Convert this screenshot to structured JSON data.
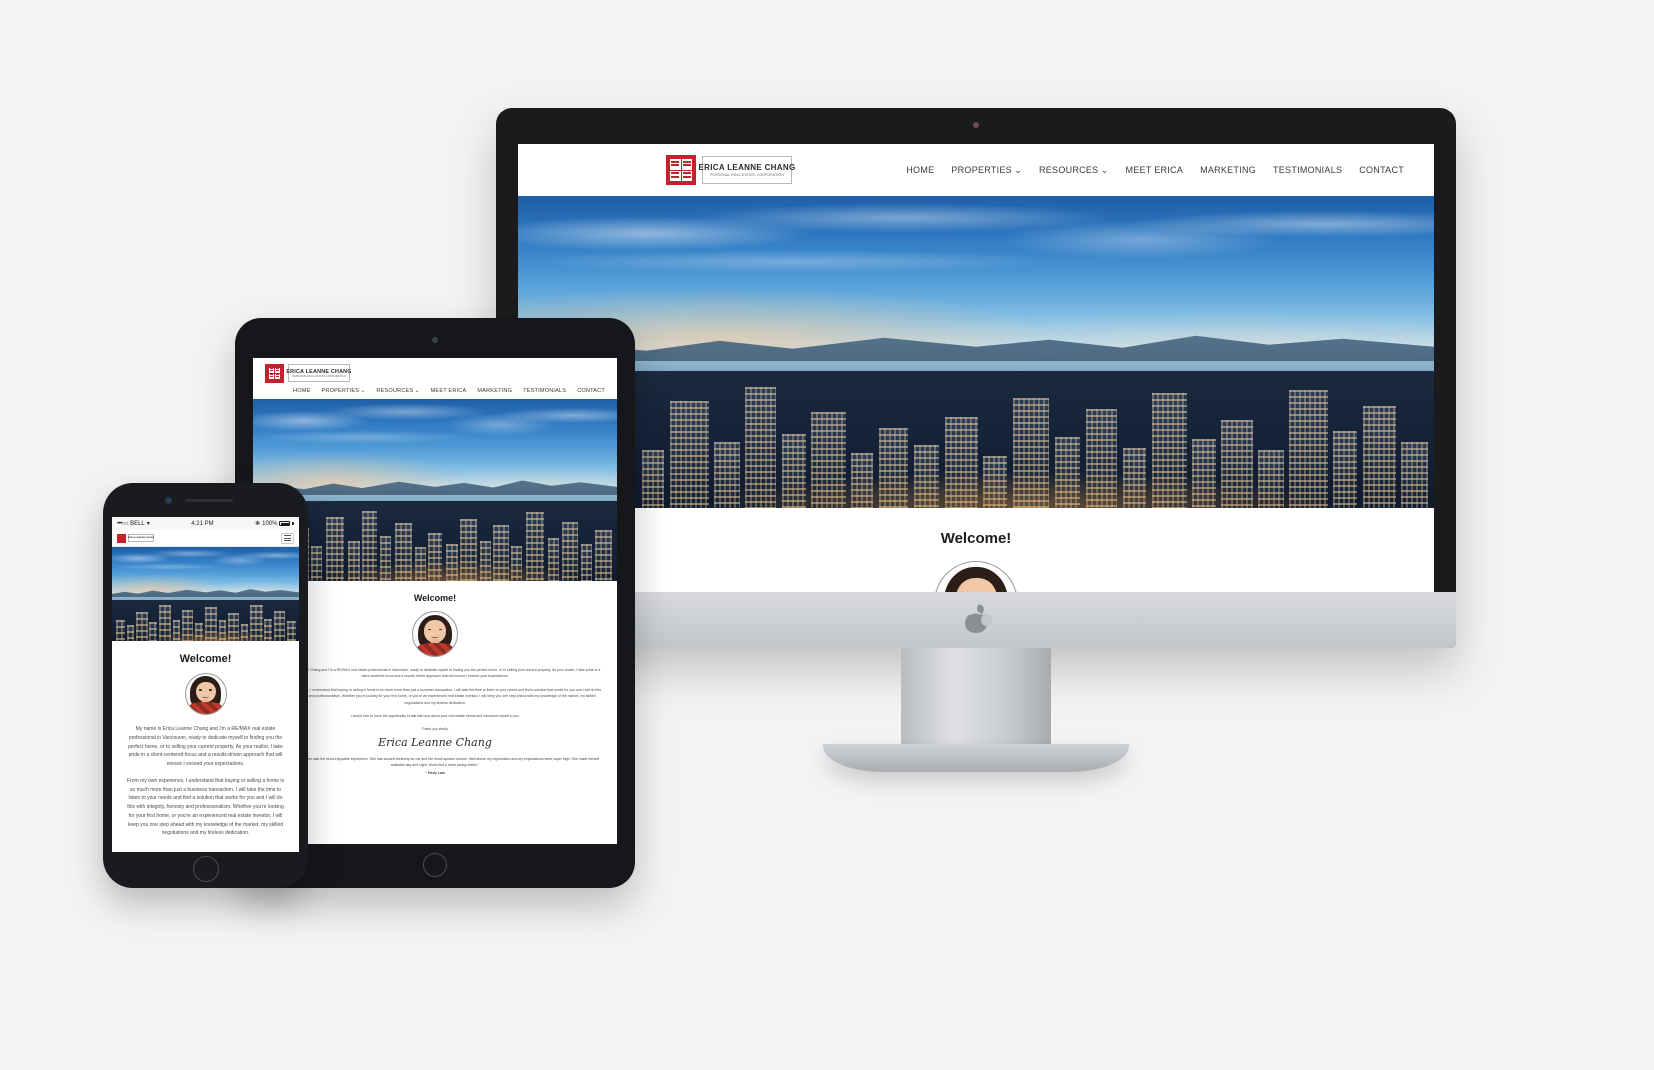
{
  "scene": {
    "background_color": "#f3f3f3",
    "description": "Responsive website mockup shown on iMac desktop, iPad tablet and iPhone"
  },
  "site": {
    "brand": {
      "seal_alt": "red-chinese-seal",
      "name": "ERICA LEANNE CHANG",
      "subtitle": "PERSONAL REAL ESTATE CORPORATION",
      "accent_color": "#c0232b"
    },
    "nav": [
      {
        "label": "HOME",
        "has_dropdown": false
      },
      {
        "label": "PROPERTIES",
        "has_dropdown": true
      },
      {
        "label": "RESOURCES",
        "has_dropdown": true
      },
      {
        "label": "MEET ERICA",
        "has_dropdown": false
      },
      {
        "label": "MARKETING",
        "has_dropdown": false
      },
      {
        "label": "TESTIMONIALS",
        "has_dropdown": false
      },
      {
        "label": "CONTACT",
        "has_dropdown": false
      }
    ],
    "caret_glyph": "⌄",
    "hero_alt": "vancouver-city-skyline-at-dusk",
    "welcome": {
      "title": "Welcome!",
      "avatar_alt": "portrait-of-erica-leanne-chang",
      "paragraph_1": "My name is Erica Leanne Chang and I'm a RE/MAX real estate professional in Vancouver, ready to dedicate myself to finding you the perfect home, or to selling your current property. As your realtor, I take pride in a client-centered focus and a results-driven approach that will ensure I exceed your expectations.",
      "paragraph_2": "From my own experience, I understand that buying or selling a home is so much more than just a business transaction. I will take the time to listen to your needs and find a solution that works for you and I will do this with integrity, honesty and professionalism. Whether you're looking for your first home, or you're an experienced real estate investor, I will keep you one step ahead with my knowledge of the market, my skilled negotiations and my tireless dedication.",
      "paragraph_3": "I would love to have the opportunity to talk with you about your real estate needs and introduce myself to you",
      "closing": "Thank you kindly,",
      "signature": "Erica Leanne Chang"
    },
    "testimonial": {
      "quote": "\"Erica made my first home sale the most enjoyable experience. She has worked tirelessly for me and the result speaks volume. Well above my expectation and my expectations were super high. She made herself available day and night. Won't find a more caring realtor.\"",
      "author": "~ Hedy Lam"
    }
  },
  "phone": {
    "status_bar": {
      "signal_dots": "•••○○",
      "carrier": "BELL",
      "wifi_glyph": "▾",
      "time": "4:21 PM",
      "bluetooth_glyph": "✻",
      "battery": "100%"
    },
    "menu_icon": "hamburger-menu-icon"
  },
  "devices": {
    "desktop": {
      "name": "iMac",
      "brand_mark": "apple-logo"
    },
    "tablet": {
      "name": "iPad"
    },
    "mobile": {
      "name": "iPhone"
    }
  }
}
